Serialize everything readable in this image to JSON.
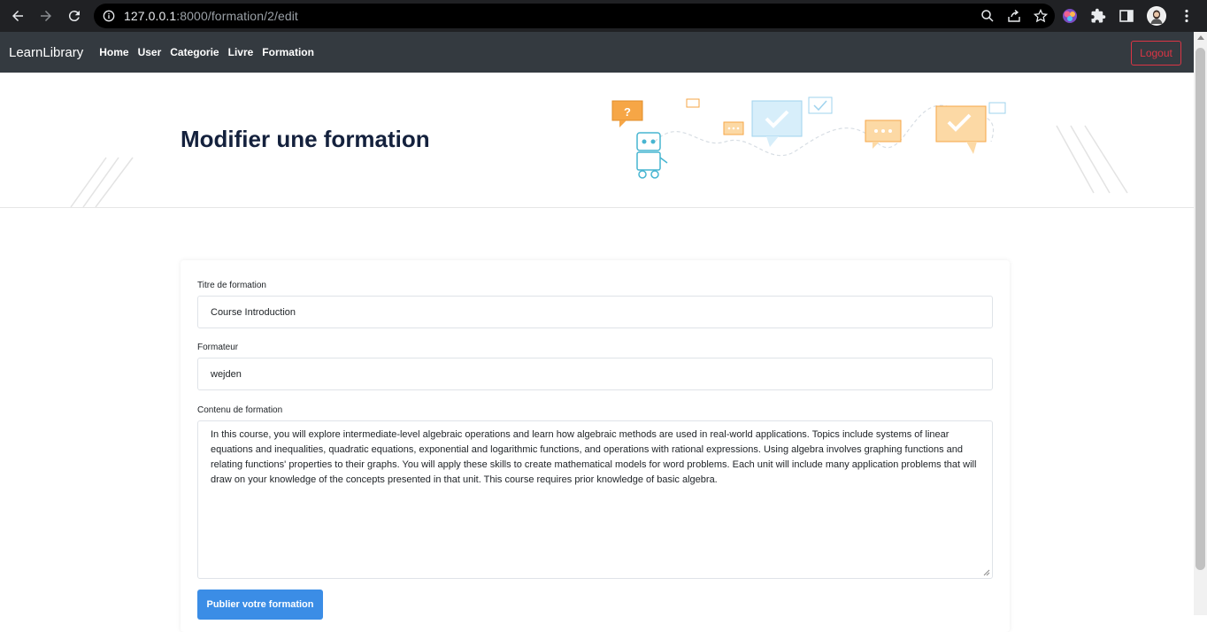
{
  "browser": {
    "url_host": "127.0.0.1",
    "url_path": ":8000/formation/2/edit"
  },
  "navbar": {
    "brand": "LearnLibrary",
    "links": [
      "Home",
      "User",
      "Categorie",
      "Livre",
      "Formation"
    ],
    "logout_label": "Logout"
  },
  "hero": {
    "title": "Modifier une formation"
  },
  "form": {
    "title_label": "Titre de formation",
    "title_value": "Course Introduction",
    "trainer_label": "Formateur",
    "trainer_value": "wejden",
    "content_label": "Contenu de formation",
    "content_value": "In this course, you will explore intermediate-level algebraic operations and learn how algebraic methods are used in real-world applications. Topics include systems of linear equations and inequalities, quadratic equations, exponential and logarithmic functions, and operations with rational expressions. Using algebra involves graphing functions and relating functions' properties to their graphs. You will apply these skills to create mathematical models for word problems. Each unit will include many application problems that will draw on your knowledge of the concepts presented in that unit. This course requires prior knowledge of basic algebra.",
    "submit_label": "Publier votre formation"
  },
  "colors": {
    "navbar_bg": "#343a40",
    "logout_red": "#dc3545",
    "primary_blue": "#3b8de6",
    "title_navy": "#14213d"
  }
}
